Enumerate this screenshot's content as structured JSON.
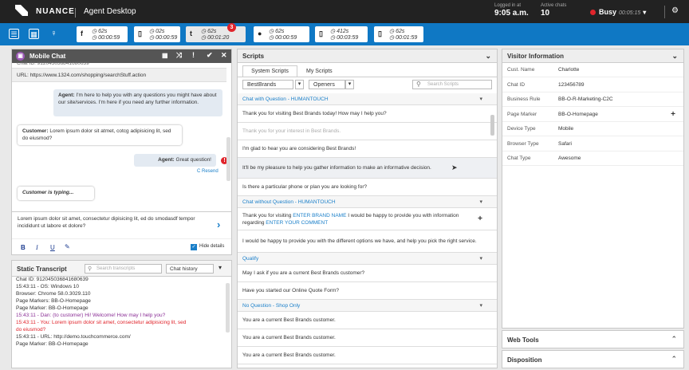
{
  "topbar": {
    "brand": "NUANCE",
    "title": "Agent Desktop",
    "logged_label": "Logged in at",
    "logged_value": "9:05 a.m.",
    "active_label": "Active chats",
    "active_value": "10",
    "status": "Busy",
    "status_timer": "00:05:15"
  },
  "chips": [
    {
      "icon": "f",
      "t1": "62s",
      "t2": "00:00:59"
    },
    {
      "icon": "▯",
      "t1": "02s",
      "t2": "00:00:59"
    },
    {
      "icon": "t",
      "t1": "62s",
      "t2": "00:01:20",
      "badge": "3"
    },
    {
      "icon": "●",
      "t1": "62s",
      "t2": "00:00:59"
    },
    {
      "icon": "▯",
      "t1": "412s",
      "t2": "00:03:59"
    },
    {
      "icon": "▯",
      "t1": "62s",
      "t2": "00:01:59"
    }
  ],
  "mobile_chat": {
    "title": "Mobile Chat",
    "chat_id_cut": "Chat ID: 912045036841680639",
    "url": "URL: https://www.1324.com/shopping/searchStuff.action",
    "agent_msg1_label": "Agent:",
    "agent_msg1": "I'm here to help you with any questions you might have about our site/services. I'm here if you need any further information.",
    "cust_label": "Customer:",
    "cust_msg": "Lorem ipsum dolor sit atmet, cotcg adipisicing lit, sed do eiusmod?",
    "agent_msg2_label": "Agent:",
    "agent_msg2": "Great question!",
    "resend": "C Resend",
    "typing": "Customer is typing...",
    "draft": "Lorem ipsum dolor sit amet, consectetur dipisicing lit, ed do smodasdf tempor incididunt ut labore et dolore?",
    "fmt": [
      "B",
      "I",
      "U"
    ],
    "hide_details": "Hide details"
  },
  "transcript": {
    "title": "Static Transcript",
    "search_placeholder": "Search transcripts",
    "history_label": "Chat history",
    "lines": [
      {
        "t": "Chat ID: 912045036841680639",
        "c": "#333"
      },
      {
        "t": "15:43:11 - OS: Windows 10",
        "c": "#333"
      },
      {
        "t": "Browser: Chrome 58.0.3029.110",
        "c": "#333"
      },
      {
        "t": "Page Markers: BB-O-Homepage",
        "c": "#333"
      },
      {
        "t": "Page Marker: BB-O-Homepage",
        "c": "#333"
      },
      {
        "t": "15:43:11 - Dan: (to customer) Hi! Welcome! How may I help you?",
        "c": "#8b2f96"
      },
      {
        "t": "15:43:11 - You: Lorem ipsum dolor sit amet, consectetur adipisicing lit, sed",
        "c": "#e0242b"
      },
      {
        "t": "do eiusmod?",
        "c": "#e0242b"
      },
      {
        "t": "15:43:11 - URL: http://demo.touchcommerce.com/",
        "c": "#333"
      },
      {
        "t": "Page Marker: BB-O-Homepage",
        "c": "#333"
      }
    ]
  },
  "scripts": {
    "title": "Scripts",
    "tab1": "System Scripts",
    "tab2": "My Scripts",
    "filter1": "BestBrands",
    "filter2": "Openers",
    "search_placeholder": "Search Scripts",
    "rows": [
      {
        "type": "cat",
        "text": "Chat with Question - HUMANTOUCH"
      },
      {
        "type": "item",
        "text": "Thank you for visiting Best Brands today! How may I help you?"
      },
      {
        "type": "dim",
        "text": "Thank you for your interest in Best Brands."
      },
      {
        "type": "item",
        "text": "I'm glad to hear you are considering Best Brands!"
      },
      {
        "type": "hover",
        "text": "It'll be my pleasure to help you gather information to make an informative decision."
      },
      {
        "type": "item",
        "text": "Is there a particular phone or plan you are looking for?"
      },
      {
        "type": "cat",
        "text": "Chat without Question - HUMANTOUCH"
      },
      {
        "type": "rich",
        "a": "Thank you for visiting ",
        "b": "ENTER BRAND NAME",
        "c": " I would be happy to provide you with information regarding ",
        "d": "ENTER YOUR COMMENT"
      },
      {
        "type": "item2",
        "text": "I would be happy to provide you with the different options we have, and help you pick the right service."
      },
      {
        "type": "cat",
        "text": "Qualify"
      },
      {
        "type": "item",
        "text": "May I ask if you are a current Best Brands customer?"
      },
      {
        "type": "item",
        "text": "Have you started our Online Quote Form?"
      },
      {
        "type": "cat",
        "text": "No Question - Shop Only"
      },
      {
        "type": "item",
        "text": "You are a current Best Brands customer."
      },
      {
        "type": "item",
        "text": "You are a current Best Brands customer."
      },
      {
        "type": "item",
        "text": "You are a current Best Brands customer."
      }
    ]
  },
  "visitor": {
    "title": "Visitor Information",
    "rows": [
      {
        "k": "Cust. Name",
        "v": "Charlotte"
      },
      {
        "k": "Chat ID",
        "v": "123456789"
      },
      {
        "k": "Business Rule",
        "v": "BB-O-R-Marketing-C2C"
      },
      {
        "k": "Page Marker",
        "v": "BB-O-Homepage"
      },
      {
        "k": "Device Type",
        "v": "Mobile"
      },
      {
        "k": "Browser Type",
        "v": "Safari"
      },
      {
        "k": "Chat Type",
        "v": "Awesome"
      }
    ]
  },
  "web_tools": "Web Tools",
  "disposition": "Disposition"
}
